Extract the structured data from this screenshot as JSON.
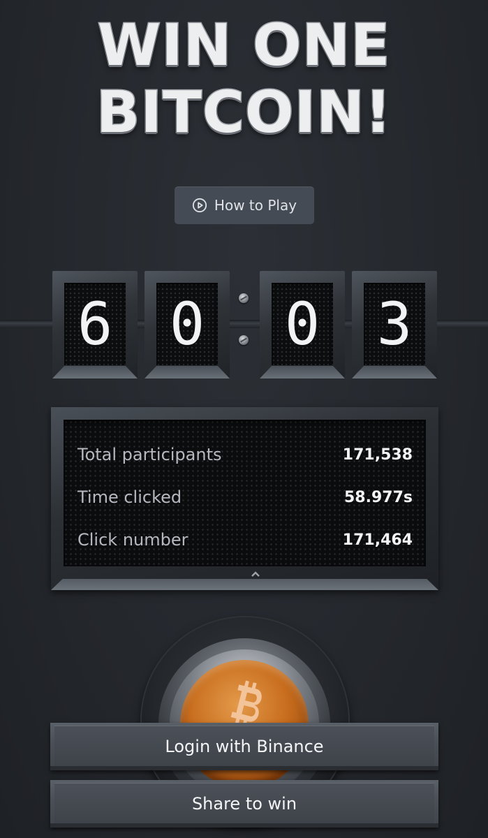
{
  "title": {
    "line1": "WIN ONE",
    "line2": "BITCOIN!"
  },
  "how_to_play": {
    "label": "How to Play",
    "icon": "play-circle-icon"
  },
  "counter": {
    "digits": [
      "6",
      "0",
      "0",
      "3"
    ]
  },
  "stats": [
    {
      "label": "Total participants",
      "value": "171,538"
    },
    {
      "label": "Time clicked",
      "value": "58.977s"
    },
    {
      "label": "Click number",
      "value": "171,464"
    }
  ],
  "collapse_icon": "chevron-up-icon",
  "bitcoin_button": {
    "icon": "bitcoin-icon",
    "color": "#c86d1e"
  },
  "actions": {
    "login_label": "Login with Binance",
    "share_label": "Share to win"
  }
}
